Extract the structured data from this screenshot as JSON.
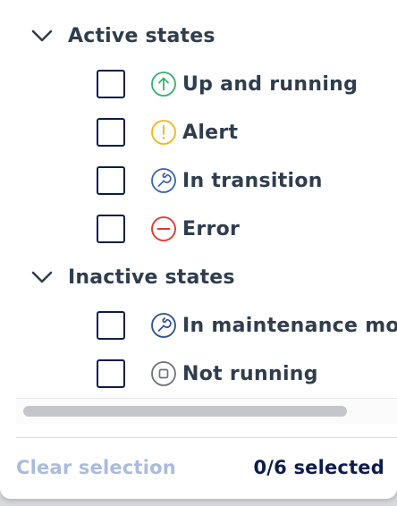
{
  "groups": [
    {
      "title": "Active states",
      "expanded": true,
      "items": [
        {
          "label": "Up and running",
          "icon": "arrow-up-circle-icon",
          "color": "#34b36b",
          "checked": false
        },
        {
          "label": "Alert",
          "icon": "exclamation-circle-icon",
          "color": "#f2b61b",
          "checked": false
        },
        {
          "label": "In transition",
          "icon": "wrench-circle-icon",
          "color": "#3f63a8",
          "checked": false
        },
        {
          "label": "Error",
          "icon": "minus-circle-icon",
          "color": "#e3342f",
          "checked": false
        }
      ]
    },
    {
      "title": "Inactive states",
      "expanded": true,
      "items": [
        {
          "label": "In maintenance mode",
          "icon": "wrench-circle-icon",
          "color": "#2f4f8f",
          "checked": false
        },
        {
          "label": "Not running",
          "icon": "stop-circle-icon",
          "color": "#6f7378",
          "checked": false
        }
      ]
    }
  ],
  "footer": {
    "clear_label": "Clear selection",
    "selected_count": "0/6 selected"
  },
  "colors": {
    "checkbox_border": "#0c1d4a",
    "text": "#2f3d4d",
    "clear_disabled": "#a9bcdc",
    "count_text": "#0c1d4a"
  }
}
